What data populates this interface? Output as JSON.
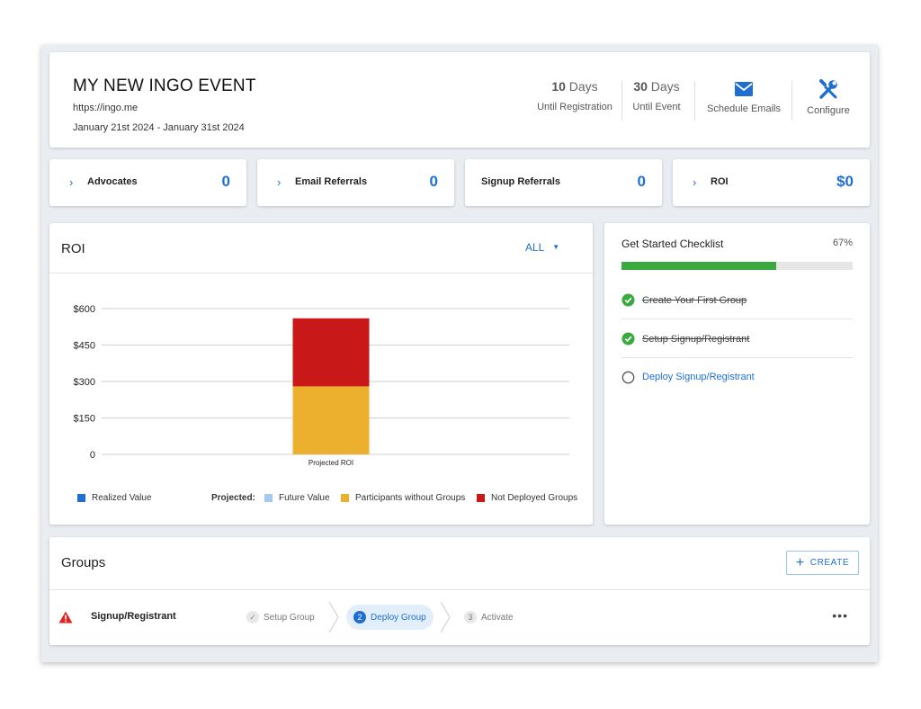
{
  "event": {
    "title": "MY NEW INGO EVENT",
    "url": "https://ingo.me",
    "dates": "January 21st 2024 - January 31st 2024"
  },
  "stats": [
    {
      "value": "10",
      "unit": "Days",
      "label": "Until Registration"
    },
    {
      "value": "30",
      "unit": "Days",
      "label": "Until Event"
    }
  ],
  "actions": {
    "schedule_emails": {
      "label": "Schedule Emails",
      "icon": "envelope-icon"
    },
    "configure": {
      "label": "Configure",
      "icon": "wrench-screwdriver-icon"
    }
  },
  "metrics": [
    {
      "label": "Advocates",
      "value": "0",
      "chevron": true
    },
    {
      "label": "Email Referrals",
      "value": "0",
      "chevron": true
    },
    {
      "label": "Signup Referrals",
      "value": "0",
      "chevron": false
    },
    {
      "label": "ROI",
      "value": "$0",
      "chevron": true
    }
  ],
  "roi": {
    "title": "ROI",
    "filter": "ALL",
    "legend": {
      "realized": "Realized Value",
      "projected_label": "Projected:",
      "future": "Future Value",
      "participants": "Participants without Groups",
      "not_deployed": "Not Deployed Groups"
    }
  },
  "chart_data": {
    "type": "bar",
    "stacked": true,
    "categories": [
      "Projected ROI"
    ],
    "series": [
      {
        "name": "Realized Value",
        "values": [
          0
        ],
        "color": "#1f6fd1"
      },
      {
        "name": "Future Value",
        "values": [
          0
        ],
        "color": "#a6c9f0"
      },
      {
        "name": "Participants without Groups",
        "values": [
          280
        ],
        "color": "#ecaf2e"
      },
      {
        "name": "Not Deployed Groups",
        "values": [
          280
        ],
        "color": "#c81818"
      }
    ],
    "yticks": [
      0,
      150,
      300,
      450,
      600
    ],
    "ytick_labels": [
      "0",
      "$150",
      "$300",
      "$450",
      "$600"
    ],
    "ylim": [
      0,
      600
    ],
    "grid": true,
    "legend_position": "bottom"
  },
  "checklist": {
    "title": "Get Started Checklist",
    "percent_label": "67%",
    "progress": 0.67,
    "items": [
      {
        "label": "Create Your First Group",
        "done": true
      },
      {
        "label": "Setup Signup/Registrant",
        "done": true
      },
      {
        "label": "Deploy Signup/Registrant",
        "done": false
      }
    ]
  },
  "groups": {
    "title": "Groups",
    "create_label": "CREATE",
    "rows": [
      {
        "name": "Signup/Registrant",
        "steps": [
          {
            "num": "✓",
            "label": "Setup Group",
            "state": "done"
          },
          {
            "num": "2",
            "label": "Deploy Group",
            "state": "active"
          },
          {
            "num": "3",
            "label": "Activate",
            "state": "pending"
          }
        ],
        "more": "•••"
      }
    ]
  },
  "colors": {
    "accent": "#1f6fd1",
    "success": "#3aaa3f",
    "warning": "#e02424"
  }
}
